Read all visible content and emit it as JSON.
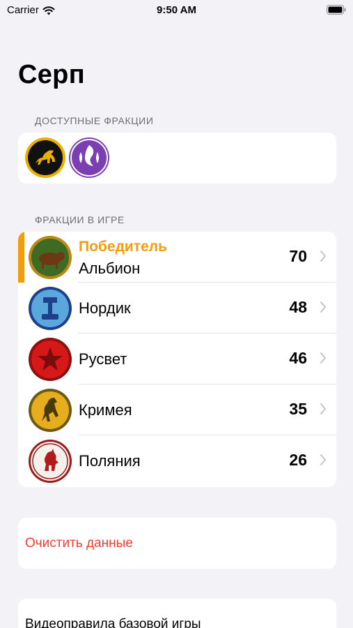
{
  "status_bar": {
    "carrier": "Carrier",
    "time": "9:50 AM"
  },
  "title": "Серп",
  "available": {
    "header": "ДОСТУПНЫЕ ФРАКЦИИ",
    "icons": [
      "saxony-faction-icon",
      "togawa-faction-icon"
    ]
  },
  "players": {
    "header": "ФРАКЦИИ В ИГРЕ",
    "winner_label": "Победитель",
    "rows": [
      {
        "name": "Альбион",
        "score": "70",
        "icon": "albion-faction-icon",
        "winner": true
      },
      {
        "name": "Нордик",
        "score": "48",
        "icon": "nordic-faction-icon",
        "winner": false
      },
      {
        "name": "Русвет",
        "score": "46",
        "icon": "rusviet-faction-icon",
        "winner": false
      },
      {
        "name": "Кримея",
        "score": "35",
        "icon": "crimea-faction-icon",
        "winner": false
      },
      {
        "name": "Поляния",
        "score": "26",
        "icon": "polania-faction-icon",
        "winner": false
      }
    ]
  },
  "actions": {
    "clear_data": "Очистить данные",
    "video_rules": "Видеоправила базовой игры"
  },
  "colors": {
    "accent_winner": "#f39c12",
    "destructive": "#ff3b30",
    "background": "#f2f2f7"
  }
}
